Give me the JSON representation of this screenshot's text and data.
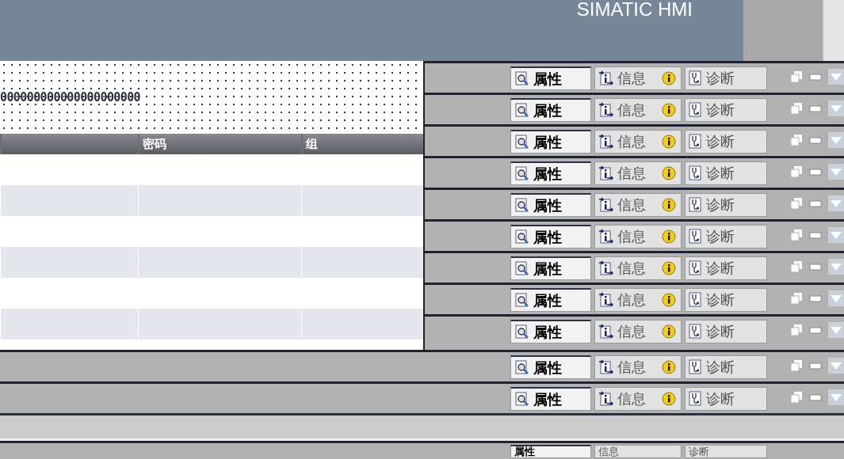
{
  "header": {
    "title": "SIMATIC HMI"
  },
  "editor": {
    "text": "000000000000000000000",
    "columns": [
      {
        "label": "密码"
      },
      {
        "label": "组"
      }
    ]
  },
  "inspectors": [
    {
      "kind": "full",
      "tabs": [
        {
          "label": "属性",
          "selected": true
        },
        {
          "label": "信息",
          "selected": false
        },
        {
          "label": "诊断",
          "selected": false
        }
      ]
    },
    {
      "kind": "full",
      "tabs": [
        {
          "label": "属性",
          "selected": true
        },
        {
          "label": "信息",
          "selected": false
        },
        {
          "label": "诊断",
          "selected": false
        }
      ]
    },
    {
      "kind": "full",
      "tabs": [
        {
          "label": "属性",
          "selected": true
        },
        {
          "label": "信息",
          "selected": false
        },
        {
          "label": "诊断",
          "selected": false
        }
      ]
    },
    {
      "kind": "full",
      "tabs": [
        {
          "label": "属性",
          "selected": true
        },
        {
          "label": "信息",
          "selected": false
        },
        {
          "label": "诊断",
          "selected": false
        }
      ]
    },
    {
      "kind": "full",
      "tabs": [
        {
          "label": "属性",
          "selected": true
        },
        {
          "label": "信息",
          "selected": false
        },
        {
          "label": "诊断",
          "selected": false
        }
      ]
    },
    {
      "kind": "full",
      "tabs": [
        {
          "label": "属性",
          "selected": true
        },
        {
          "label": "信息",
          "selected": false
        },
        {
          "label": "诊断",
          "selected": false
        }
      ]
    },
    {
      "kind": "full",
      "tabs": [
        {
          "label": "属性",
          "selected": true
        },
        {
          "label": "信息",
          "selected": false
        },
        {
          "label": "诊断",
          "selected": false
        }
      ]
    },
    {
      "kind": "full",
      "tabs": [
        {
          "label": "属性",
          "selected": true
        },
        {
          "label": "信息",
          "selected": false
        },
        {
          "label": "诊断",
          "selected": false
        }
      ]
    },
    {
      "kind": "full",
      "tabs": [
        {
          "label": "属性",
          "selected": true
        },
        {
          "label": "信息",
          "selected": false
        },
        {
          "label": "诊断",
          "selected": false
        }
      ]
    },
    {
      "kind": "full",
      "tabs": [
        {
          "label": "属性",
          "selected": true
        },
        {
          "label": "信息",
          "selected": false
        },
        {
          "label": "诊断",
          "selected": false
        }
      ]
    },
    {
      "kind": "full",
      "tabs": [
        {
          "label": "属性",
          "selected": true
        },
        {
          "label": "信息",
          "selected": false
        },
        {
          "label": "诊断",
          "selected": false
        }
      ]
    },
    {
      "kind": "partial",
      "tabs": [
        {
          "label": "属性",
          "selected": true
        },
        {
          "label": "信息",
          "selected": false
        },
        {
          "label": "诊断",
          "selected": false
        }
      ]
    }
  ]
}
